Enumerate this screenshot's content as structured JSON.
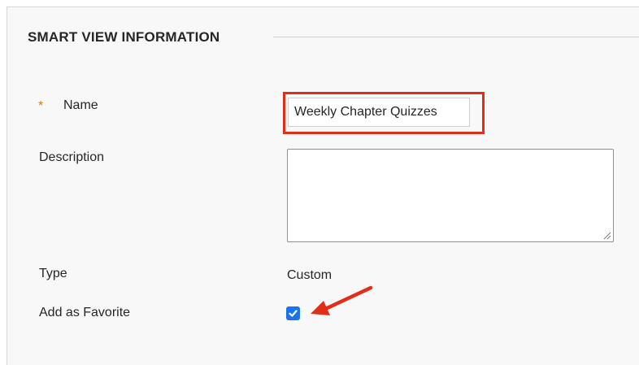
{
  "section": {
    "title": "SMART VIEW INFORMATION"
  },
  "form": {
    "name": {
      "label": "Name",
      "required_marker": "*",
      "value": "Weekly Chapter Quizzes"
    },
    "description": {
      "label": "Description",
      "value": ""
    },
    "type": {
      "label": "Type",
      "value": "Custom"
    },
    "favorite": {
      "label": "Add as Favorite",
      "checked": true
    }
  },
  "annotations": {
    "highlight_color": "#e12e14",
    "arrow_color": "#e12e14"
  },
  "colors": {
    "required_star": "#e07b00",
    "checkbox_accent": "#1a73e8",
    "panel_bg": "#f8f8f8"
  },
  "icons": {
    "checkbox": "check-icon",
    "textarea_grip": "resize-grip-icon",
    "annotation": "arrow-annotation"
  }
}
